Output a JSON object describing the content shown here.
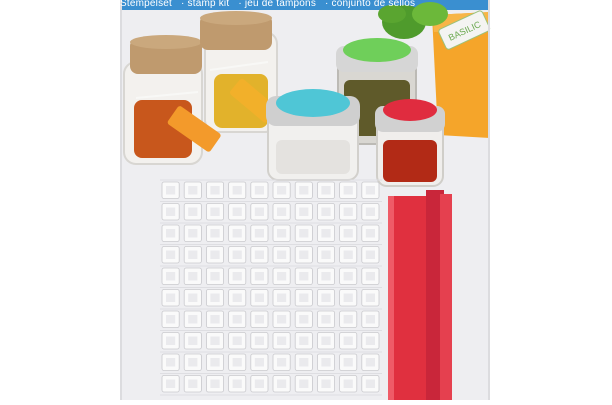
{
  "header": {
    "titles": [
      "Stempelset",
      "· stamp kit",
      "· jeu de tampons",
      "· conjunto de sellos"
    ]
  },
  "labels": {
    "basil_tag": "BASILIC"
  },
  "colors": {
    "header_band": "#3a8fd0",
    "backdrop": "#eeeef1",
    "cork": "#bf9a6e",
    "stamp_red": "#e0303f",
    "tag_orange": "#f39a2b",
    "lid_blue": "#4fc6d6",
    "lid_green": "#6fcf5a",
    "lid_red": "#e02c3f",
    "pot_orange": "#f5a52a",
    "basil_green": "#4f9b2c"
  },
  "stamp_grid": {
    "rows": 10,
    "cols": 10
  },
  "icons": [
    "cork-jar",
    "spice-jar",
    "stamp-handle",
    "letter-stamp"
  ]
}
